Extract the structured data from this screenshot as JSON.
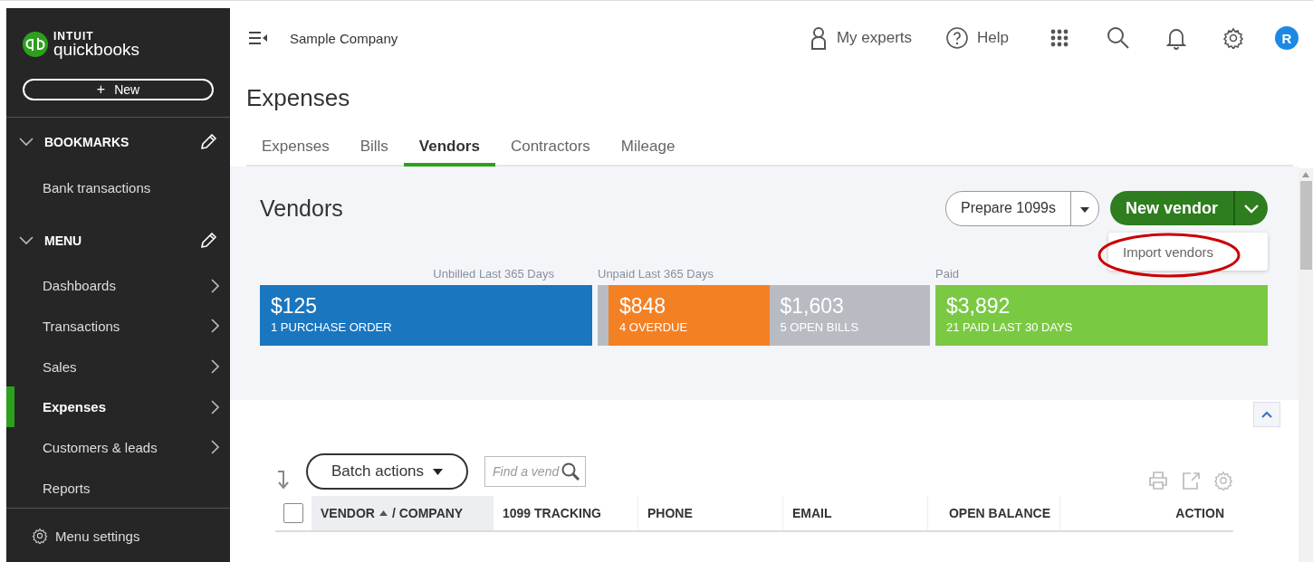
{
  "sidebar": {
    "logo": {
      "brand": "INTUIT",
      "product": "quickbooks"
    },
    "new_button": {
      "icon": "+",
      "label": "New"
    },
    "sections": [
      {
        "title": "BOOKMARKS",
        "expanded": true,
        "items": [
          {
            "label": "Bank transactions",
            "selected": false,
            "chevron": false
          }
        ]
      },
      {
        "title": "MENU",
        "expanded": true,
        "items": [
          {
            "label": "Dashboards",
            "selected": false,
            "chevron": true
          },
          {
            "label": "Transactions",
            "selected": false,
            "chevron": true
          },
          {
            "label": "Sales",
            "selected": false,
            "chevron": true
          },
          {
            "label": "Expenses",
            "selected": true,
            "chevron": true
          },
          {
            "label": "Customers & leads",
            "selected": false,
            "chevron": true
          },
          {
            "label": "Reports",
            "selected": false,
            "chevron": false
          }
        ]
      }
    ],
    "footer": "Menu settings"
  },
  "topbar": {
    "company": "Sample Company",
    "experts": "My experts",
    "help": "Help",
    "avatar": "R"
  },
  "page_title": "Expenses",
  "tabs": [
    {
      "label": "Expenses",
      "selected": false
    },
    {
      "label": "Bills",
      "selected": false
    },
    {
      "label": "Vendors",
      "selected": true
    },
    {
      "label": "Contractors",
      "selected": false
    },
    {
      "label": "Mileage",
      "selected": false
    }
  ],
  "vendors_panel": {
    "title": "Vendors",
    "prepare_button": "Prepare 1099s",
    "new_vendor_button": "New vendor",
    "dropdown_items": [
      "Import vendors"
    ],
    "money_bar": [
      {
        "label": "Unbilled Last 365 Days",
        "segments": [
          {
            "kind": "amount",
            "amount": "$125",
            "caption": "1 PURCHASE ORDER",
            "color": "#1a76bf"
          }
        ]
      },
      {
        "label": "Unpaid Last 365 Days",
        "segments": [
          {
            "kind": "strip",
            "color": "#b8bcc2"
          },
          {
            "kind": "amount",
            "amount": "$848",
            "caption": "4 OVERDUE",
            "color": "#f48024"
          },
          {
            "kind": "amount",
            "amount": "$1,603",
            "caption": "5 OPEN BILLS",
            "color": "#b8bcc2"
          }
        ]
      },
      {
        "label": "Paid",
        "segments": [
          {
            "kind": "amount",
            "amount": "$3,892",
            "caption": "21 PAID LAST 30 DAYS",
            "color": "#7ac943"
          }
        ]
      }
    ]
  },
  "table": {
    "batch_button": "Batch actions",
    "search": {
      "placeholder": "Find a vend"
    },
    "select_all": {
      "checked": false
    },
    "columns": [
      {
        "label": "VENDOR",
        "separator": "/",
        "sub": "COMPANY",
        "sorted": true,
        "right_aligned": false
      },
      {
        "label": "1099 TRACKING",
        "sorted": false,
        "right_aligned": false
      },
      {
        "label": "PHONE",
        "sorted": false,
        "right_aligned": false
      },
      {
        "label": "EMAIL",
        "sorted": false,
        "right_aligned": false
      },
      {
        "label": "OPEN BALANCE",
        "sorted": false,
        "right_aligned": true
      },
      {
        "label": "ACTION",
        "sorted": false,
        "right_aligned": true
      }
    ]
  }
}
